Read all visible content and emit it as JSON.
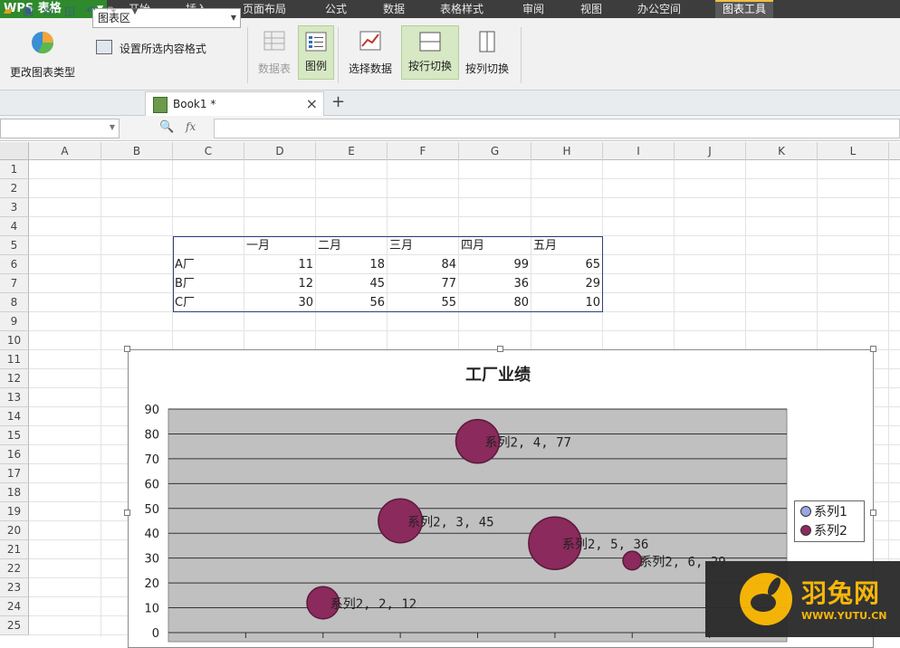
{
  "app": {
    "logo": "WPS 表格"
  },
  "menu": {
    "tabs": [
      "开始",
      "插入",
      "页面布局",
      "公式",
      "数据",
      "表格样式",
      "审阅",
      "视图",
      "办公空间",
      "图表工具"
    ],
    "active": "图表工具"
  },
  "ribbon": {
    "change_chart_type": "更改图表类型",
    "chart_area_value": "图表区",
    "format_selection": "设置所选内容格式",
    "data_table": "数据表",
    "legend": "图例",
    "select_data": "选择数据",
    "switch_by_row": "按行切换",
    "switch_by_col": "按列切换"
  },
  "document": {
    "tab_name": "Book1 *"
  },
  "formula": {
    "fx": "fx"
  },
  "sheet": {
    "columns": [
      "A",
      "B",
      "C",
      "D",
      "E",
      "F",
      "G",
      "H",
      "I",
      "J",
      "K",
      "L"
    ],
    "rows": [
      "1",
      "2",
      "3",
      "4",
      "5",
      "6",
      "7",
      "8",
      "9",
      "10",
      "11",
      "12",
      "13",
      "14",
      "15",
      "16",
      "17",
      "18",
      "19",
      "20",
      "21",
      "22",
      "23",
      "24",
      "25"
    ],
    "table": {
      "headers": [
        "一月",
        "二月",
        "三月",
        "四月",
        "五月"
      ],
      "rows": [
        {
          "label": "A厂",
          "values": [
            "11",
            "18",
            "84",
            "99",
            "65"
          ]
        },
        {
          "label": "B厂",
          "values": [
            "12",
            "45",
            "77",
            "36",
            "29"
          ]
        },
        {
          "label": "C厂",
          "values": [
            "30",
            "56",
            "55",
            "80",
            "10"
          ]
        }
      ]
    }
  },
  "chart_data": {
    "type": "bubble",
    "title": "工厂业绩",
    "ylim": [
      0,
      90
    ],
    "yticks": [
      "0",
      "10",
      "20",
      "30",
      "40",
      "50",
      "60",
      "70",
      "80",
      "90"
    ],
    "grid": true,
    "plot_bg": "#c0c0c0",
    "legend_position": "right",
    "series": [
      {
        "name": "系列1",
        "color": "#9aa6e0",
        "points": []
      },
      {
        "name": "系列2",
        "color": "#8b2a5c",
        "points": [
          {
            "x": 2,
            "y": 12,
            "size": 30,
            "label": "系列2, 2, 12"
          },
          {
            "x": 3,
            "y": 45,
            "size": 56,
            "label": "系列2, 3, 45"
          },
          {
            "x": 4,
            "y": 77,
            "size": 55,
            "label": "系列2, 4, 77"
          },
          {
            "x": 5,
            "y": 36,
            "size": 80,
            "label": "系列2, 5, 36"
          },
          {
            "x": 6,
            "y": 29,
            "size": 10,
            "label": "系列2, 6, 29"
          }
        ]
      }
    ]
  },
  "watermark": {
    "text": "羽兔网",
    "url": "WWW.YUTU.CN"
  }
}
